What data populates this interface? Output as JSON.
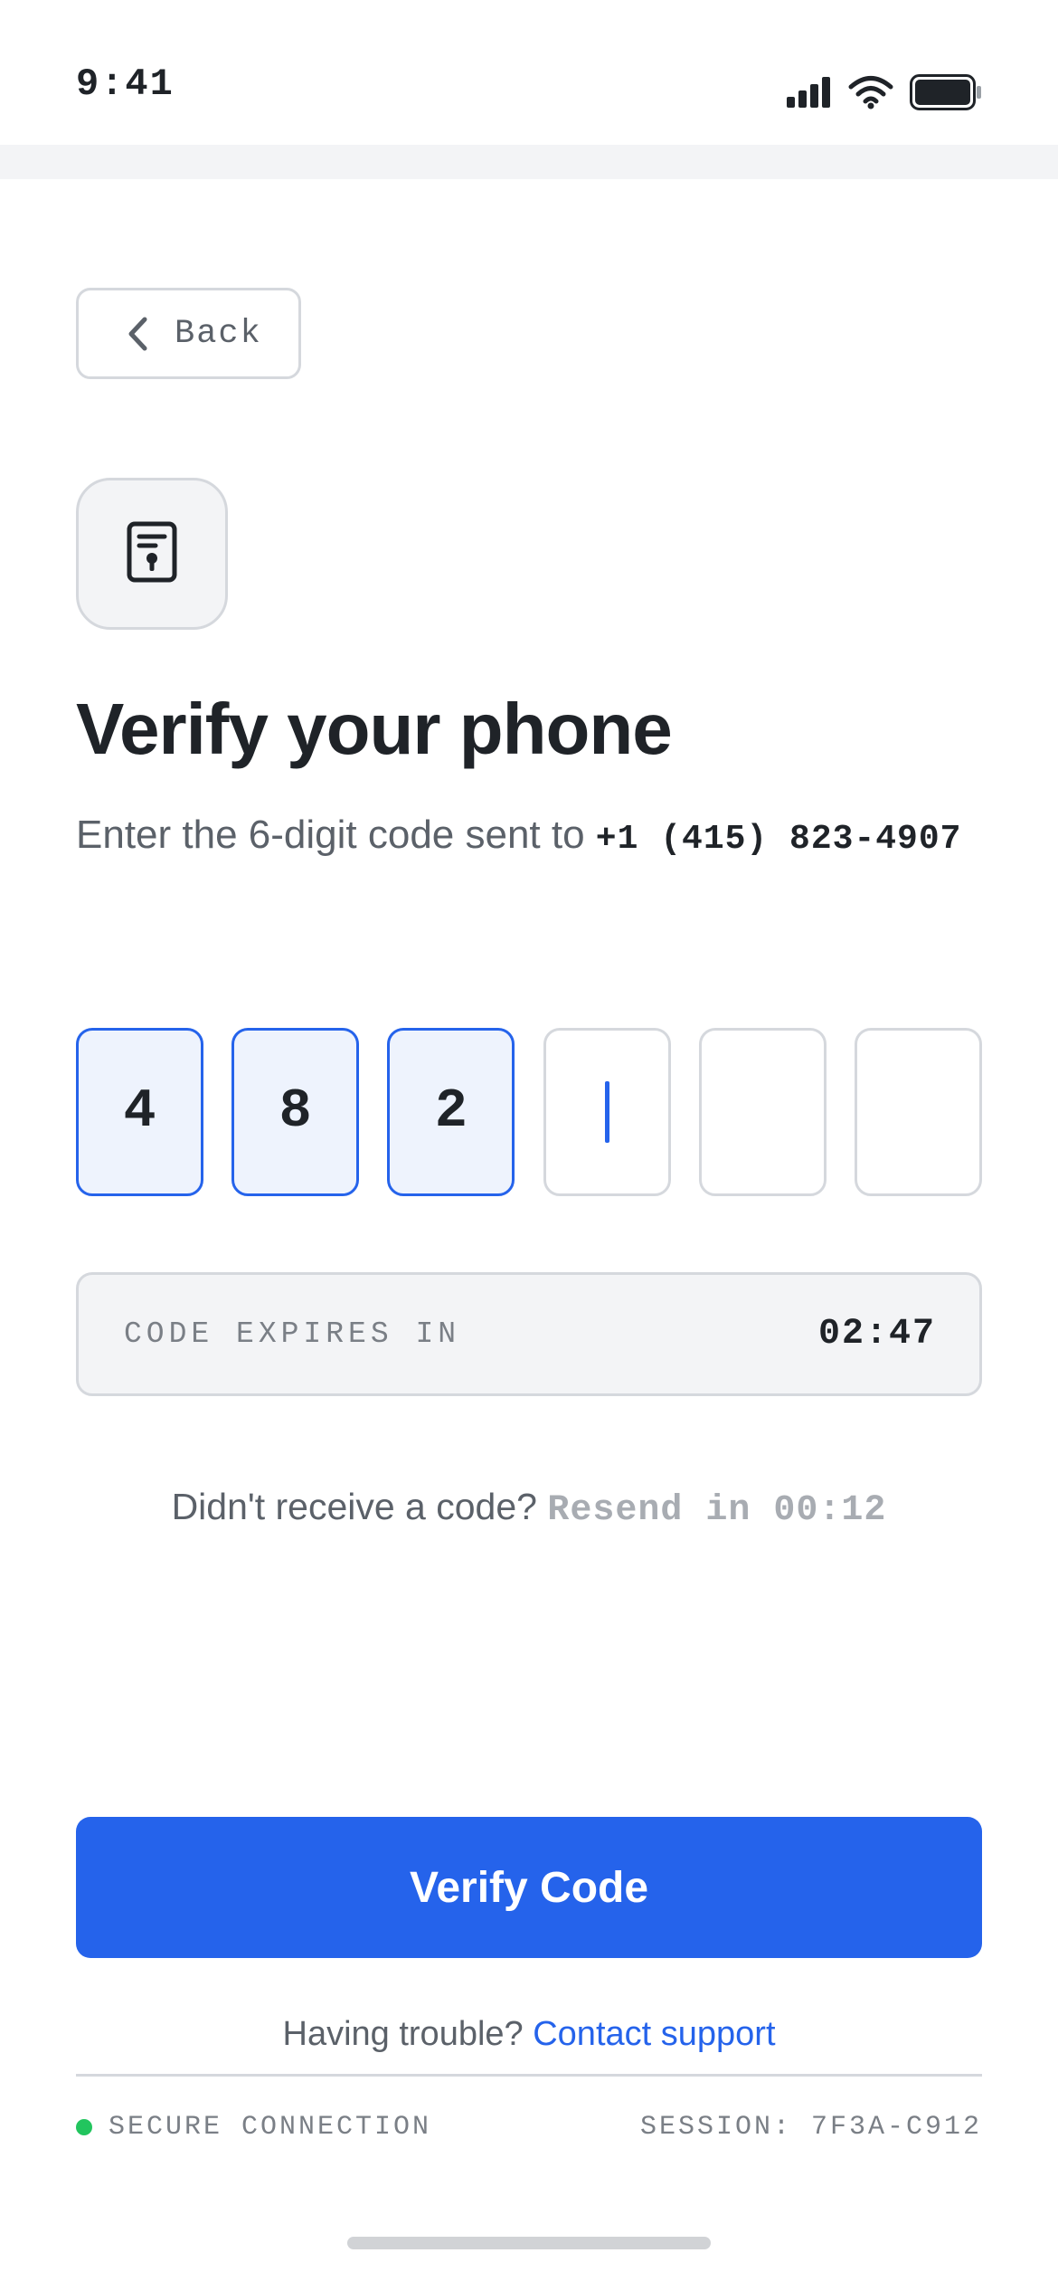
{
  "status_bar": {
    "time": "9:41",
    "icons": [
      "signal-bars-icon",
      "wifi-icon",
      "battery-icon"
    ]
  },
  "nav": {
    "back_label": "Back",
    "back_icon": "chevron-left-icon"
  },
  "header": {
    "icon": "document-lock-icon",
    "title": "Verify your phone",
    "subtitle_prefix": "Enter the 6-digit code sent to ",
    "phone_number": "+1 (415) 823-4907"
  },
  "code_input": {
    "digits": [
      "4",
      "8",
      "2",
      "",
      "",
      ""
    ],
    "active_index": 3
  },
  "timer": {
    "label": "CODE EXPIRES IN",
    "value": "02:47"
  },
  "resend": {
    "prompt": "Didn't receive a code? ",
    "countdown": "Resend in 00:12"
  },
  "actions": {
    "verify_label": "Verify Code"
  },
  "help": {
    "prompt": "Having trouble? ",
    "link_label": "Contact support"
  },
  "footer": {
    "secure_label": "SECURE CONNECTION",
    "session_label": "SESSION: 7F3A-C912"
  },
  "colors": {
    "accent": "#2563eb",
    "filled_box_bg": "#eef3fd",
    "secure_dot": "#22c55e",
    "muted_text": "#5b6169"
  }
}
